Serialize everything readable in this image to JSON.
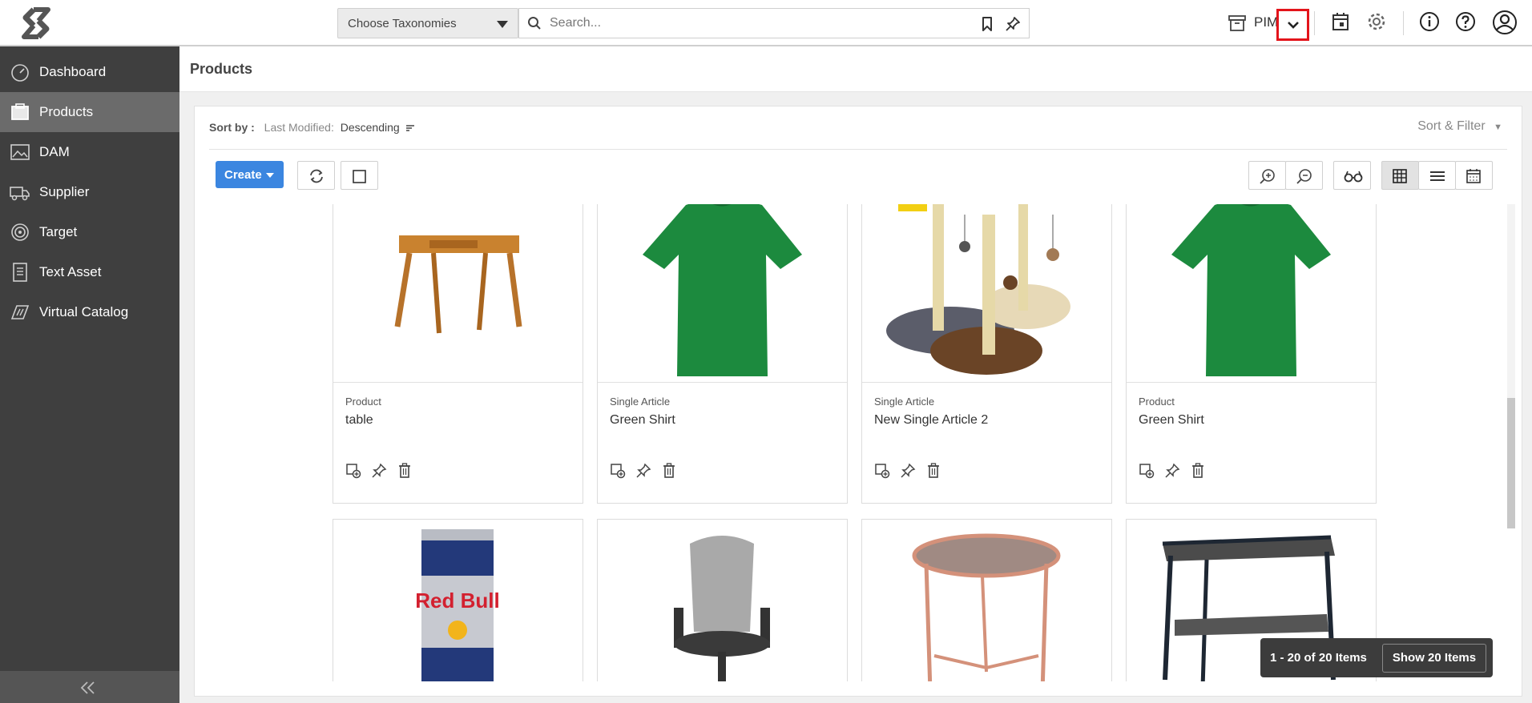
{
  "topbar": {
    "taxonomy_select": "Choose Taxonomies",
    "search_placeholder": "Search...",
    "app_label": "PIM"
  },
  "sidebar": {
    "items": [
      {
        "label": "Dashboard",
        "icon": "speedometer-icon"
      },
      {
        "label": "Products",
        "icon": "products-box-icon",
        "active": true
      },
      {
        "label": "DAM",
        "icon": "image-icon"
      },
      {
        "label": "Supplier",
        "icon": "truck-icon"
      },
      {
        "label": "Target",
        "icon": "target-icon"
      },
      {
        "label": "Text Asset",
        "icon": "document-icon"
      },
      {
        "label": "Virtual Catalog",
        "icon": "catalog-icon"
      }
    ]
  },
  "page": {
    "title": "Products",
    "sort_label": "Sort by :",
    "sort_key": "Last Modified:",
    "sort_dir": "Descending",
    "sort_filter": "Sort & Filter",
    "create_label": "Create"
  },
  "cards": [
    {
      "type": "Product",
      "name": "table",
      "image": "wooden-table"
    },
    {
      "type": "Single Article",
      "name": "Green Shirt",
      "image": "green-shirt"
    },
    {
      "type": "Single Article",
      "name": "New Single Article 2",
      "image": "cat-scratching-post"
    },
    {
      "type": "Product",
      "name": "Green Shirt",
      "image": "green-shirt"
    },
    {
      "type": "",
      "name": "",
      "image": "red-bull-can"
    },
    {
      "type": "",
      "name": "",
      "image": "office-chair"
    },
    {
      "type": "",
      "name": "",
      "image": "rose-gold-side-table"
    },
    {
      "type": "",
      "name": "",
      "image": "dark-metal-side-table"
    }
  ],
  "pager": {
    "count": "1 - 20 of 20 Items",
    "show": "Show 20 Items"
  },
  "colors": {
    "accent": "#3b86e0",
    "sidebar": "#3f3f3f",
    "highlight": "#e3141b"
  }
}
